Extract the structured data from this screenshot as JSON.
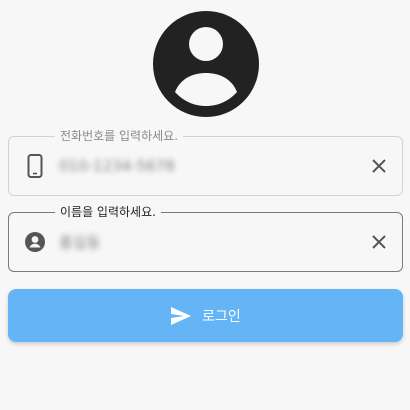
{
  "colors": {
    "background": "#f7f7f7",
    "avatar": "#222222",
    "button": "#65b5f6",
    "button_text": "#ffffff",
    "icon": "#555555"
  },
  "avatar": {
    "icon": "account-circle-icon"
  },
  "phone_field": {
    "label": "전화번호를 입력하세요.",
    "value": "010-1234-5678",
    "icon": "smartphone-icon",
    "clear_icon": "close-icon"
  },
  "name_field": {
    "label": "이름을 입력하세요.",
    "value": "홍길동",
    "icon": "person-icon",
    "clear_icon": "close-icon"
  },
  "login_button": {
    "label": "로그인",
    "icon": "send-icon"
  }
}
